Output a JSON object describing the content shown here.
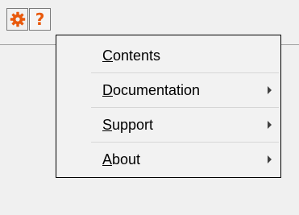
{
  "toolbar": {
    "gear_icon": "gear-icon",
    "help_glyph": "?",
    "accent_color": "#e8590c"
  },
  "menu": {
    "items": [
      {
        "accel": "C",
        "rest": "ontents",
        "label": "Contents",
        "has_submenu": false
      },
      {
        "accel": "D",
        "rest": "ocumentation",
        "label": "Documentation",
        "has_submenu": true
      },
      {
        "accel": "S",
        "rest": "upport",
        "label": "Support",
        "has_submenu": true
      },
      {
        "accel": "A",
        "rest": "bout",
        "label": "About",
        "has_submenu": true
      }
    ]
  }
}
